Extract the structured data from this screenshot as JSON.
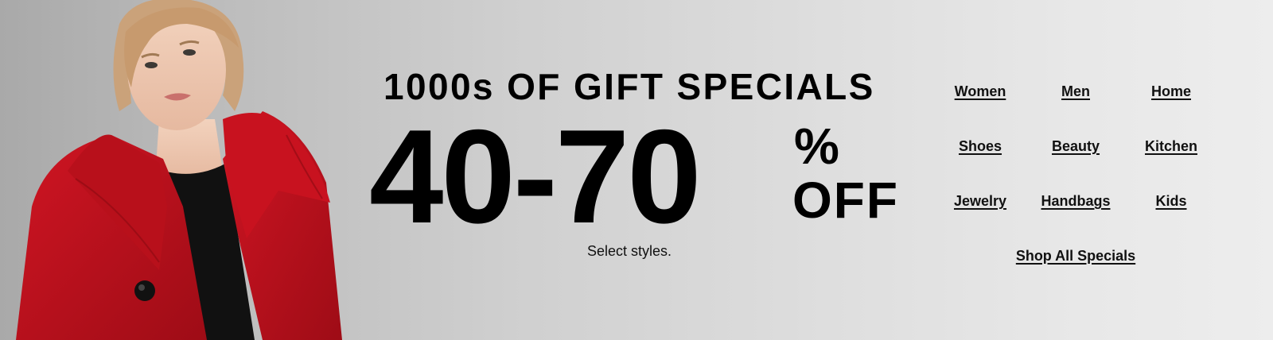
{
  "promo": {
    "headline": "1000s OF GIFT SPECIALS",
    "discount_range": "40-70",
    "percent_sign": "%",
    "off_text": "OFF",
    "fine_print": "Select styles."
  },
  "categories": [
    {
      "label": "Women"
    },
    {
      "label": "Men"
    },
    {
      "label": "Home"
    },
    {
      "label": "Shoes"
    },
    {
      "label": "Beauty"
    },
    {
      "label": "Kitchen"
    },
    {
      "label": "Jewelry"
    },
    {
      "label": "Handbags"
    },
    {
      "label": "Kids"
    }
  ],
  "shop_all": {
    "label": "Shop All Specials"
  },
  "colors": {
    "coat_red": "#c0101c",
    "text": "#000000",
    "background_left": "#a9a9a9",
    "background_right": "#ededed"
  },
  "hero": {
    "icon": "model-in-red-coat-photo"
  }
}
